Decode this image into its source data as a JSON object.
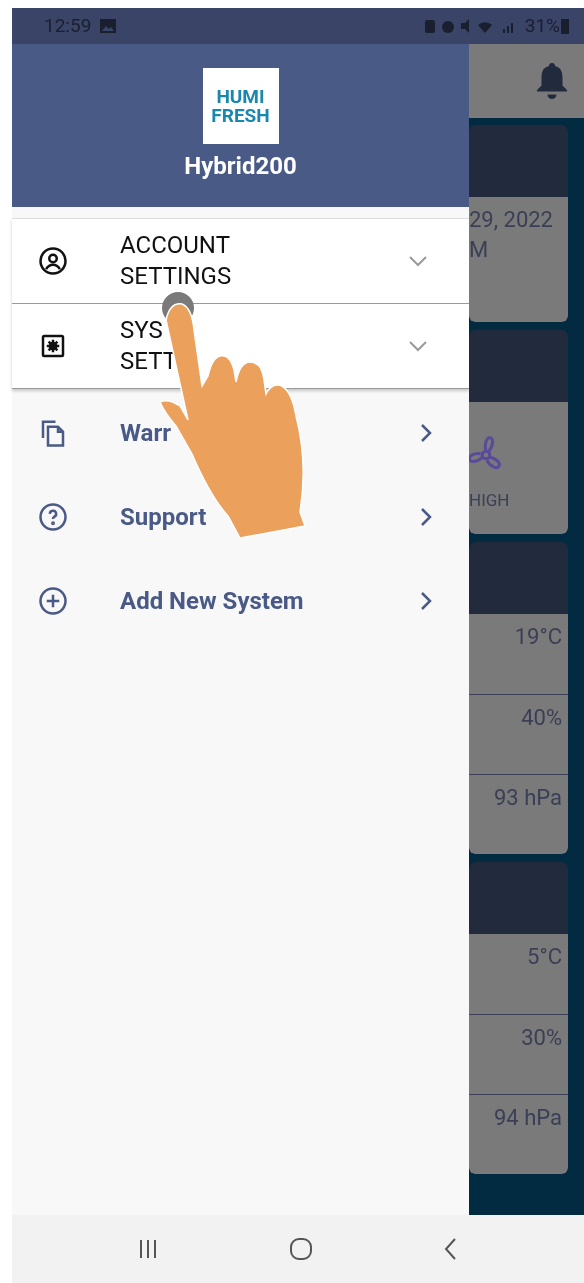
{
  "status_bar": {
    "time": "12:59",
    "battery": "31%"
  },
  "drawer": {
    "logo": {
      "line1": "HUMI",
      "line2": "FRESH"
    },
    "title": "Hybrid200",
    "items": [
      {
        "kind": "accordion",
        "lines": [
          "ACCOUNT",
          "SETTINGS"
        ],
        "expanded": false
      },
      {
        "kind": "accordion",
        "lines": [
          "SYS",
          "SETT"
        ],
        "expanded": false
      },
      {
        "kind": "link",
        "lines": [
          "Warr"
        ]
      },
      {
        "kind": "link",
        "lines": [
          "Support"
        ]
      },
      {
        "kind": "link",
        "lines": [
          "Add New System"
        ]
      }
    ]
  },
  "background_screen": {
    "cards": [
      {
        "kind": "date",
        "lines": [
          "29, 2022",
          "M"
        ]
      },
      {
        "kind": "fan",
        "label": "HIGH"
      },
      {
        "kind": "readings",
        "readings": [
          "19°C",
          "40%",
          "93 hPa"
        ]
      },
      {
        "kind": "readings",
        "readings": [
          "5°C",
          "30%",
          "94 hPa"
        ]
      }
    ]
  }
}
